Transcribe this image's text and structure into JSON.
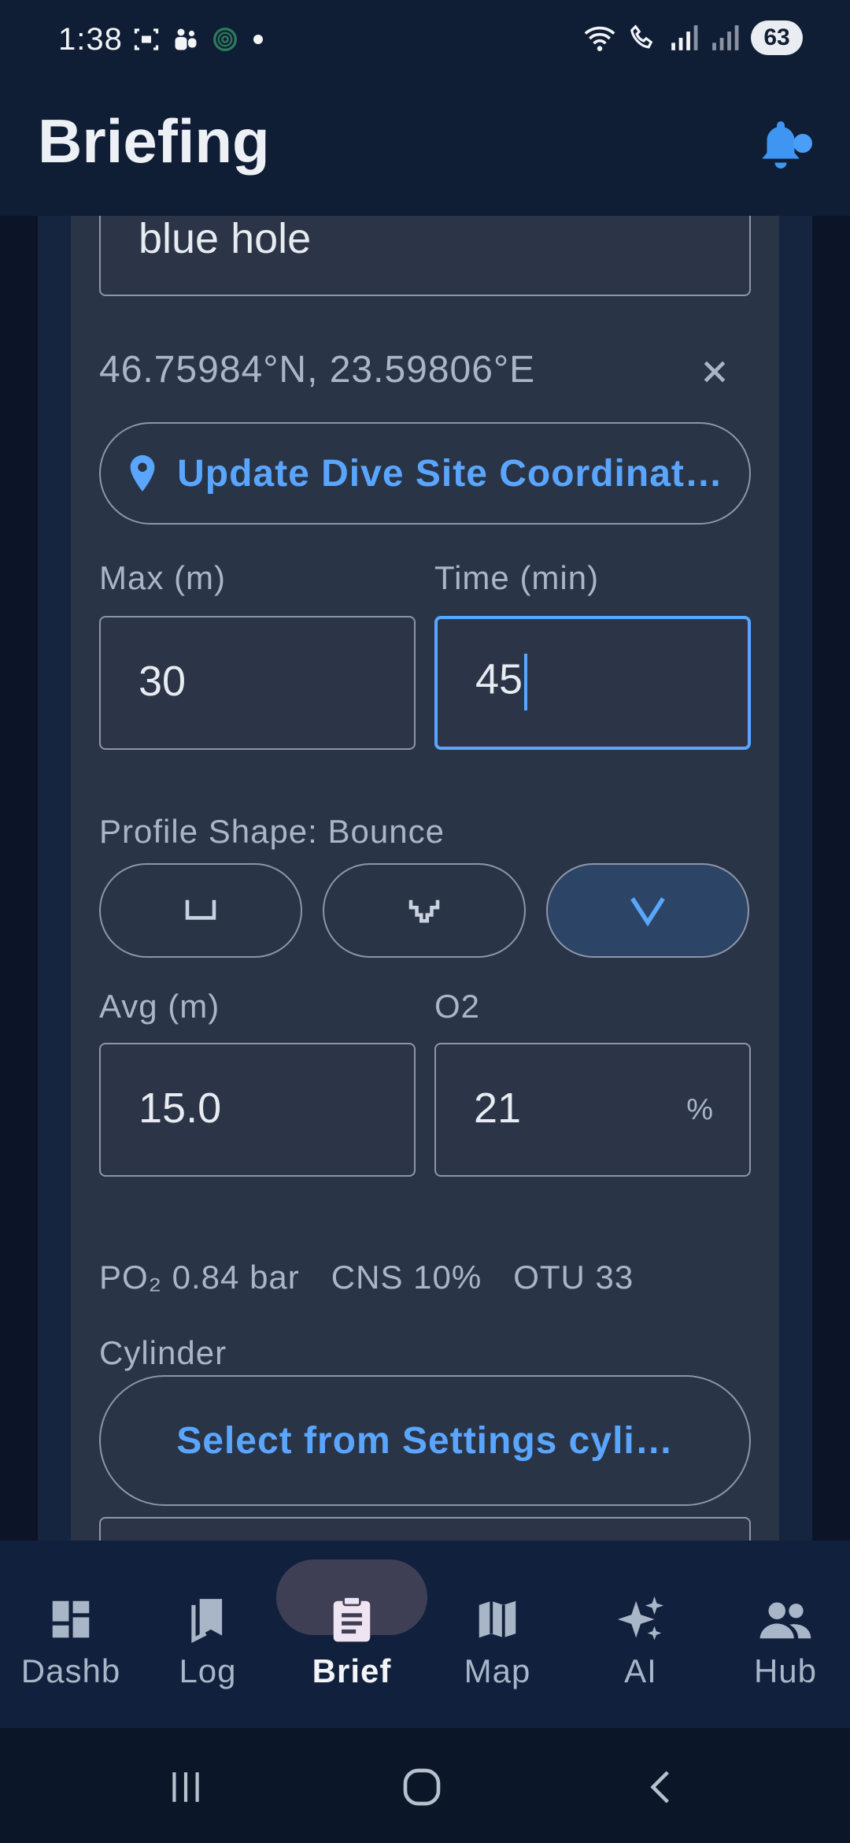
{
  "status_bar": {
    "time": "1:38",
    "battery": "63"
  },
  "app_bar": {
    "title": "Briefing"
  },
  "form": {
    "site_name_value": "blue hole",
    "coordinates": "46.75984°N, 23.59806°E",
    "update_coords_button": "Update Dive Site Coordinat…",
    "max_depth": {
      "label": "Max (m)",
      "value": "30"
    },
    "time": {
      "label": "Time (min)",
      "value": "45"
    },
    "profile_shape_label": "Profile Shape: Bounce",
    "profile_shapes": [
      {
        "name": "square",
        "selected": false
      },
      {
        "name": "multilevel",
        "selected": false
      },
      {
        "name": "bounce",
        "selected": true
      }
    ],
    "avg_depth": {
      "label": "Avg (m)",
      "value": "15.0"
    },
    "o2": {
      "label": "O2",
      "value": "21",
      "unit": "%"
    },
    "stats": {
      "po2": "PO₂ 0.84 bar",
      "cns": "CNS 10%",
      "otu": "OTU 33"
    },
    "cylinder_label": "Cylinder",
    "cylinder_button": "Select from Settings cyli…"
  },
  "bottom_nav": {
    "items": [
      {
        "label": "Dashb",
        "active": false
      },
      {
        "label": "Log",
        "active": false
      },
      {
        "label": "Brief",
        "active": true
      },
      {
        "label": "Map",
        "active": false
      },
      {
        "label": "AI",
        "active": false
      },
      {
        "label": "Hub",
        "active": false
      }
    ]
  },
  "colors": {
    "accent": "#5aa6ff",
    "surface": "#2a3447",
    "bar": "#0f1d35"
  }
}
